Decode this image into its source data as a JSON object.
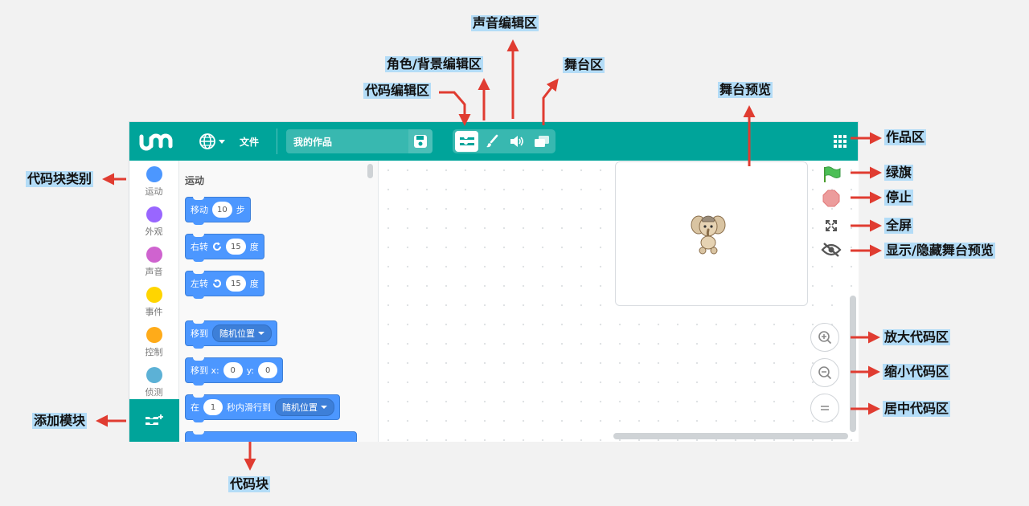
{
  "topbar": {
    "file_menu": "文件",
    "project_title": "我的作品",
    "colors": {
      "bar": "#00a49a"
    }
  },
  "categories": [
    {
      "label": "运动",
      "color": "#4c97ff"
    },
    {
      "label": "外观",
      "color": "#9966ff"
    },
    {
      "label": "声音",
      "color": "#cf63cf"
    },
    {
      "label": "事件",
      "color": "#ffd500"
    },
    {
      "label": "控制",
      "color": "#ffab19"
    },
    {
      "label": "侦测",
      "color": "#5cb1d6"
    }
  ],
  "palette": {
    "title": "运动",
    "blocks": {
      "move": {
        "label": "移动",
        "value": "10",
        "suffix": "步"
      },
      "turn_right": {
        "label": "右转",
        "value": "15",
        "suffix": "度"
      },
      "turn_left": {
        "label": "左转",
        "value": "15",
        "suffix": "度"
      },
      "goto": {
        "label": "移到",
        "dropdown": "随机位置"
      },
      "goto_xy": {
        "label": "移到 x:",
        "x": "0",
        "ylabel": "y:",
        "y": "0"
      },
      "glide": {
        "label": "在",
        "value": "1",
        "middle": "秒内滑行到",
        "dropdown": "随机位置"
      }
    }
  },
  "annotations": {
    "code_editor": "代码编辑区",
    "sprite_bg_editor": "角色/背景编辑区",
    "sound_editor": "声音编辑区",
    "stage_area": "舞台区",
    "stage_preview": "舞台预览",
    "works_area": "作品区",
    "block_categories": "代码块类别",
    "green_flag": "绿旗",
    "stop": "停止",
    "fullscreen": "全屏",
    "toggle_preview": "显示/隐藏舞台预览",
    "zoom_in": "放大代码区",
    "zoom_out": "缩小代码区",
    "center": "居中代码区",
    "add_blocks": "添加模块",
    "code_blocks": "代码块"
  },
  "icons": {
    "logo": "logo-icon",
    "language": "globe-icon",
    "save": "save-icon",
    "code_tab": "code-icon",
    "costume_tab": "brush-icon",
    "sound_tab": "speaker-icon",
    "stage_tab": "stage-icon",
    "works": "grid-icon",
    "flag": "green-flag-icon",
    "stop": "stop-icon",
    "fullscreen": "fullscreen-icon",
    "hide_preview": "eye-slash-icon",
    "zoom_in": "zoom-in-icon",
    "zoom_out": "zoom-out-icon",
    "reset": "equals-icon",
    "extension": "add-extension-icon"
  },
  "colors": {
    "annotation_bg": "#b3dcf7",
    "arrow": "#e03c31",
    "motion_block": "#4c97ff"
  }
}
